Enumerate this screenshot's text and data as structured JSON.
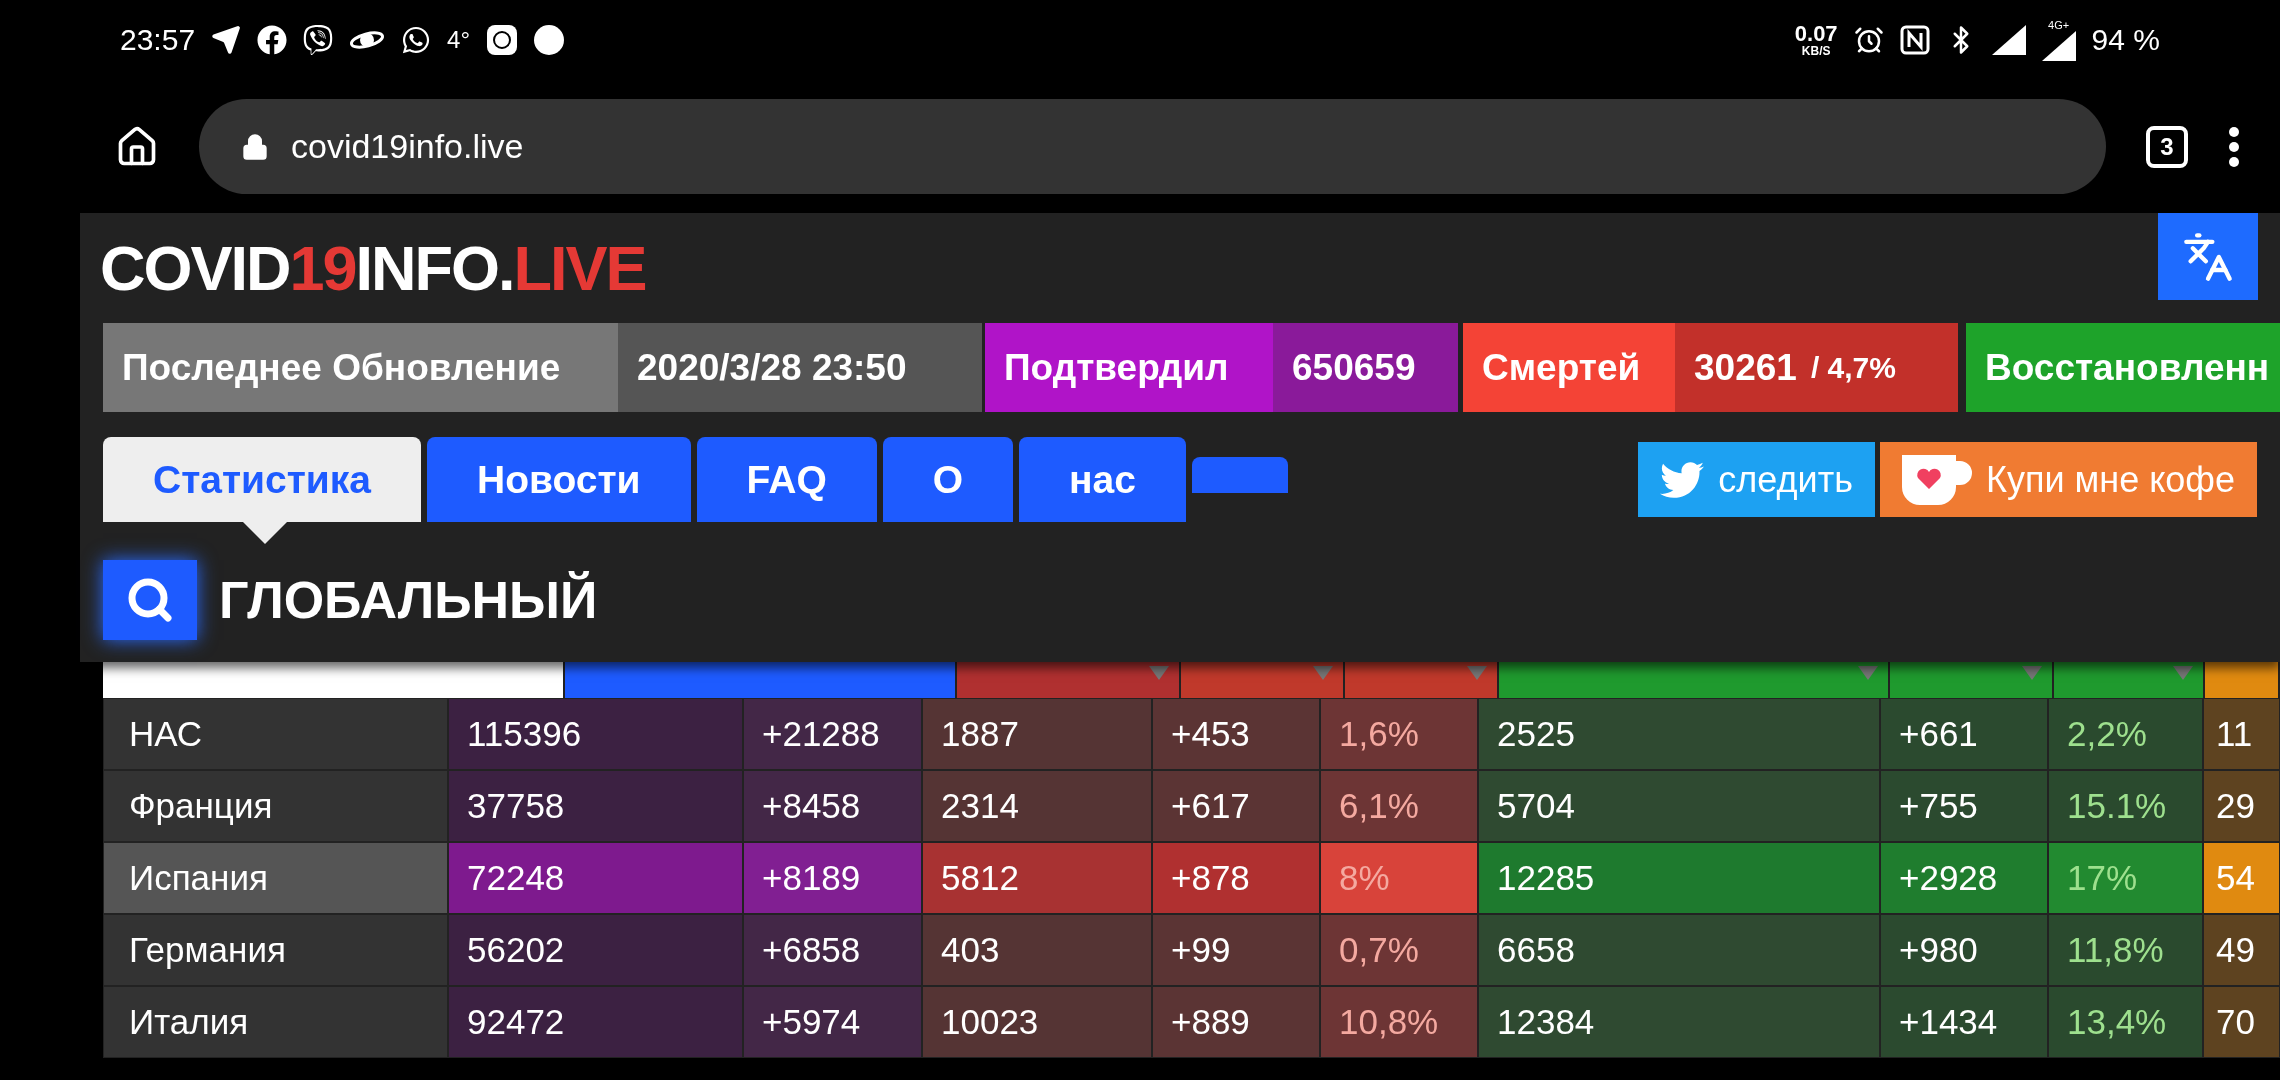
{
  "status_bar": {
    "time": "23:57",
    "temperature": "4°",
    "speed": "0.07",
    "speed_unit": "KB/S",
    "network": "4G+",
    "battery": "94 %"
  },
  "browser": {
    "url": "covid19info.live",
    "tab_count": "3"
  },
  "logo": {
    "part_1": "COVID",
    "part_2": "19",
    "part_3": "INFO.",
    "part_4": "LIVE"
  },
  "stats": [
    {
      "text": "Последнее Обновление",
      "color": "#777777"
    },
    {
      "text": "2020/3/28 23:50",
      "color": "#555555"
    },
    {
      "text": "Подтвердил",
      "color": "#b014c8"
    },
    {
      "text": "650659",
      "color": "#8a1a9a"
    },
    {
      "text": "Смертей",
      "color": "#f44336"
    },
    {
      "text": "30261",
      "extra": " / 4,7%",
      "color": "#c2302a"
    },
    {
      "text": "Восстановленн",
      "color": "#1ea32a"
    }
  ],
  "nav_tabs": [
    {
      "label": "Статистика",
      "selected": true
    },
    {
      "label": "Новости",
      "selected": false
    },
    {
      "label": "FAQ",
      "selected": false
    },
    {
      "label": "О",
      "selected": false
    },
    {
      "label": "нас",
      "selected": false
    },
    {
      "selected": false
    }
  ],
  "follow_button": "следить",
  "coffee_button": "Купи мне кофе",
  "scope_title": "ГЛОБАЛЬНЫЙ",
  "table": {
    "rows": [
      {
        "country": "НАС",
        "cells": [
          "115396",
          "+21288",
          "1887",
          "+453",
          "1,6%",
          "2525",
          "+661",
          "2,2%",
          "11"
        ],
        "selected": false
      },
      {
        "country": "Франция",
        "cells": [
          "37758",
          "+8458",
          "2314",
          "+617",
          "6,1%",
          "5704",
          "+755",
          "15.1%",
          "29"
        ],
        "selected": false
      },
      {
        "country": "Испания",
        "cells": [
          "72248",
          "+8189",
          "5812",
          "+878",
          "8%",
          "12285",
          "+2928",
          "17%",
          "54"
        ],
        "selected": true
      },
      {
        "country": "Германия",
        "cells": [
          "56202",
          "+6858",
          "403",
          "+99",
          "0,7%",
          "6658",
          "+980",
          "11,8%",
          "49"
        ],
        "selected": false
      },
      {
        "country": "Италия",
        "cells": [
          "92472",
          "+5974",
          "10023",
          "+889",
          "10,8%",
          "12384",
          "+1434",
          "13,4%",
          "70"
        ],
        "selected": false
      }
    ]
  }
}
